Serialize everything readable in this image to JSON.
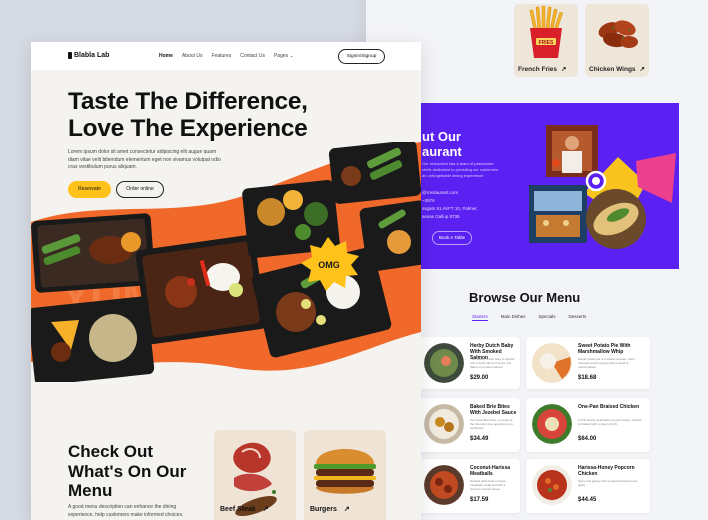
{
  "back_page": {
    "mini_cards": [
      {
        "label": "French Fries",
        "arrow": "↗"
      },
      {
        "label": "Chicken Wings",
        "arrow": "↗"
      }
    ],
    "about": {
      "title_line1": "ut Our",
      "title_line2": "aurant",
      "subtitle": "Our restaurant has a team of passionate chefs dedicated to providing our customers an unforgettable dining experience",
      "info_lines": [
        "@rrestaurant.com",
        "~3976",
        "ssgatn 51 AVFT 10, Palmer,",
        "ansas Gallup 8735"
      ],
      "button": "Book A Table"
    },
    "browse": {
      "title": "Browse Our Menu",
      "tabs": [
        "Starters",
        "Main Dishes",
        "Specials",
        "Desserts"
      ],
      "dishes": [
        {
          "name": "Herby Dutch Baby With Smoked Salmon",
          "desc": "This savory Dutch baby is topped with a fresh blend of herbs and flakes of smoked salmon.",
          "price": "$29.00"
        },
        {
          "name": "Sweet Potato Pie With Marshmallow Whip",
          "desc": "Sweet potato pie is a classic dessert, often sweetened and topped with a cloud of marshmallow.",
          "price": "$18.68"
        },
        {
          "name": "Baked Brie Bites With Jezebel Sauce",
          "desc": "For these Brie bites, a couple of the tried-and-true appetizers are combined.",
          "price": "$34.49"
        },
        {
          "name": "One-Pan Braised Chicken",
          "desc": "In this hearty weeknight one-pan recipe, chicken is braised with a savory broth.",
          "price": "$64.00"
        },
        {
          "name": "Coconut-Harissa Meatballs",
          "desc": "Harissa adds heat to these meatballs, balanced with a creamy coconut sauce.",
          "price": "$17.59"
        },
        {
          "name": "Harissa-Honey Popcorn Chicken",
          "desc": "Spicy and glossy with a sweet harissa-honey glaze.",
          "price": "$44.45"
        }
      ]
    }
  },
  "front_page": {
    "nav": {
      "brand": "Blabla Lab",
      "links": [
        "Home",
        "About Us",
        "Features",
        "Contact Us",
        "Pages"
      ],
      "pages_caret": "⌄",
      "signin": "Signin/Signup"
    },
    "hero": {
      "title_line1": "Taste The Difference,",
      "title_line2": "Love The Experience",
      "subtitle": "Lorem ipsum dolor sit amet consectetur adipiscing elit augue quam diam vitae velit bibendum elementum eget non vivamus volutpat odio cras vestibulum purus aliquam.",
      "reserve_button": "Reservate",
      "order_button": "Order online",
      "badge": "OMG"
    },
    "menu_section": {
      "title_line1": "Check Out",
      "title_line2": "What's On Our",
      "title_line3": "Menu",
      "subtitle": "A good menu description can enhance the dining experience, help customers make informed choices.",
      "categories": [
        {
          "label": "Beef Steak",
          "arrow": "↗"
        },
        {
          "label": "Burgers",
          "arrow": "↗"
        }
      ]
    }
  },
  "colors": {
    "accent_yellow": "#ffc21a",
    "accent_purple": "#5b21f2",
    "hero_orange": "#f0682a"
  }
}
